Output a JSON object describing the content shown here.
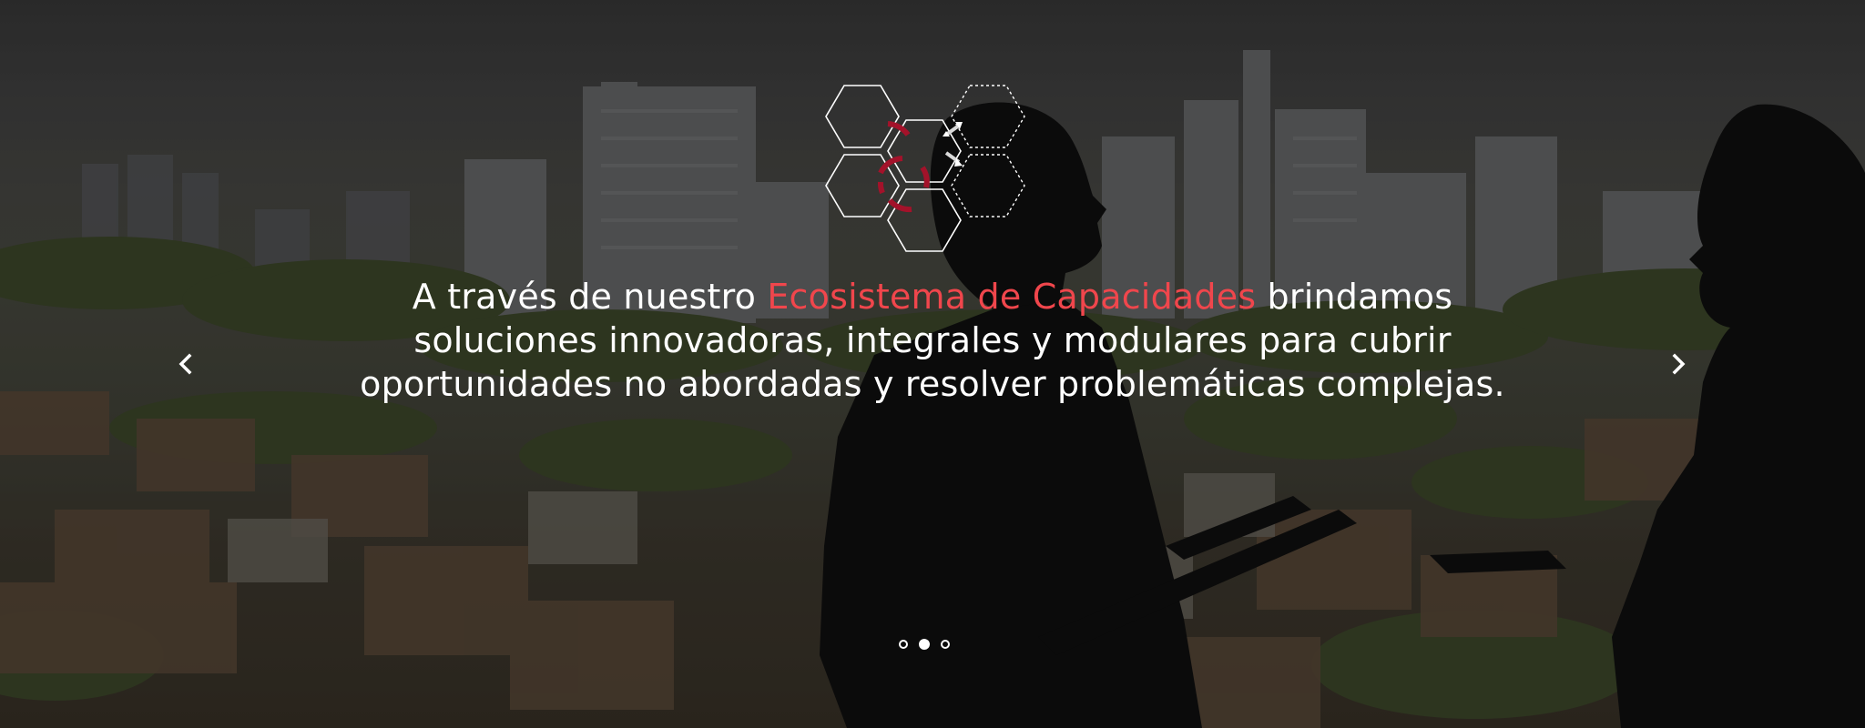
{
  "hero": {
    "headline_before": "A través de nuestro ",
    "headline_accent": "Ecosistema de Capacidades",
    "headline_after": " brindamos soluciones innovadoras, integrales y modulares para cubrir oportunidades no abordadas y resolver problemáticas complejas.",
    "accent_color": "#f0464c",
    "text_color": "#ffffff"
  },
  "logo": {
    "icon": "hexagon-ecosystem-icon",
    "stroke_color": "#ffffff",
    "accent_color": "#a3122a"
  },
  "carousel": {
    "prev_icon": "chevron-left-icon",
    "next_icon": "chevron-right-icon",
    "slide_count": 3,
    "active_slide": 2
  }
}
